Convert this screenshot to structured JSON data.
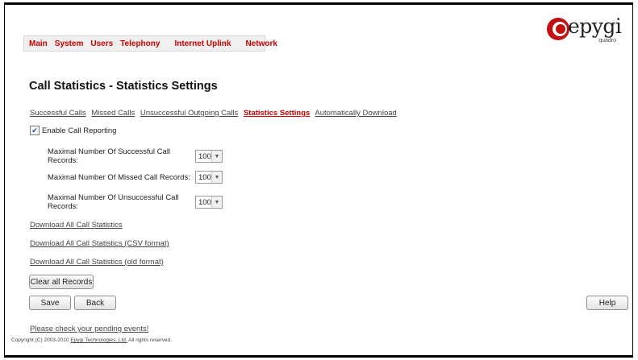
{
  "nav": {
    "items": [
      "Main",
      "System",
      "Users",
      "Telephony",
      "Internet Uplink",
      "Network"
    ]
  },
  "logo": {
    "brand": "epygi",
    "model": "quadro"
  },
  "page": {
    "title": "Call Statistics - Statistics Settings"
  },
  "tabs": [
    {
      "label": "Successful Calls"
    },
    {
      "label": "Missed Calls"
    },
    {
      "label": "Unsuccessful Outgoing Calls"
    },
    {
      "label": "Statistics Settings",
      "active": true
    },
    {
      "label": "Automatically Download"
    }
  ],
  "enable_reporting": {
    "label": "Enable Call Reporting",
    "checked": true
  },
  "records": [
    {
      "label": "Maximal Number Of Successful Call Records:",
      "value": "100"
    },
    {
      "label": "Maximal Number Of Missed Call Records:",
      "value": "100"
    },
    {
      "label": "Maximal Number Of Unsuccessful Call Records:",
      "value": "100"
    }
  ],
  "downloads": [
    "Download All Call Statistics",
    "Download All Call Statistics (CSV format)",
    "Download All Call Statistics (old format)"
  ],
  "buttons": {
    "clear": "Clear all Records",
    "save": "Save",
    "back": "Back",
    "help": "Help"
  },
  "footer": {
    "pending": "Please check your pending events!",
    "copyright_prefix": "Copyright (C) 2003-2010",
    "company": "Epygi Technologies, Ltd.",
    "rights": "All rights reserved."
  },
  "colors": {
    "accent": "#cc0000",
    "link": "#444444"
  }
}
